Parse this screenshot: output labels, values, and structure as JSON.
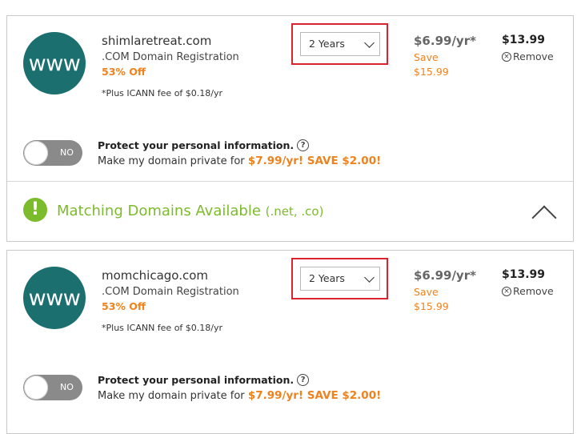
{
  "items": [
    {
      "logo_text": "www",
      "domain": "shimlaretreat.com",
      "product": ".COM Domain Registration",
      "discount": "53% Off",
      "icann_note": "*Plus ICANN fee of $0.18/yr",
      "term_selected": "2 Years",
      "price": "$6.99/yr*",
      "save_label": "Save",
      "original_price": "$15.99",
      "total": "$13.99",
      "remove_label": "Remove",
      "toggle_label": "NO",
      "privacy_title": "Protect your personal information.",
      "privacy_prefix": "Make my domain private for",
      "privacy_offer": "$7.99/yr! SAVE $2.00!"
    },
    {
      "logo_text": "www",
      "domain": "momchicago.com",
      "product": ".COM Domain Registration",
      "discount": "53% Off",
      "icann_note": "*Plus ICANN fee of $0.18/yr",
      "term_selected": "2 Years",
      "price": "$6.99/yr*",
      "save_label": "Save",
      "original_price": "$15.99",
      "total": "$13.99",
      "remove_label": "Remove",
      "toggle_label": "NO",
      "privacy_title": "Protect your personal information.",
      "privacy_prefix": "Make my domain private for",
      "privacy_offer": "$7.99/yr! SAVE $2.00!"
    }
  ],
  "matching": {
    "title": "Matching Domains Available",
    "extensions": "(.net, .co)",
    "icon": "exclamation-icon",
    "toggle_icon": "chevron-up-icon"
  },
  "colors": {
    "brand_teal": "#1b6f6e",
    "accent_orange": "#f0821e",
    "highlight_red": "#d9232e",
    "success_green": "#7cbb2b"
  }
}
